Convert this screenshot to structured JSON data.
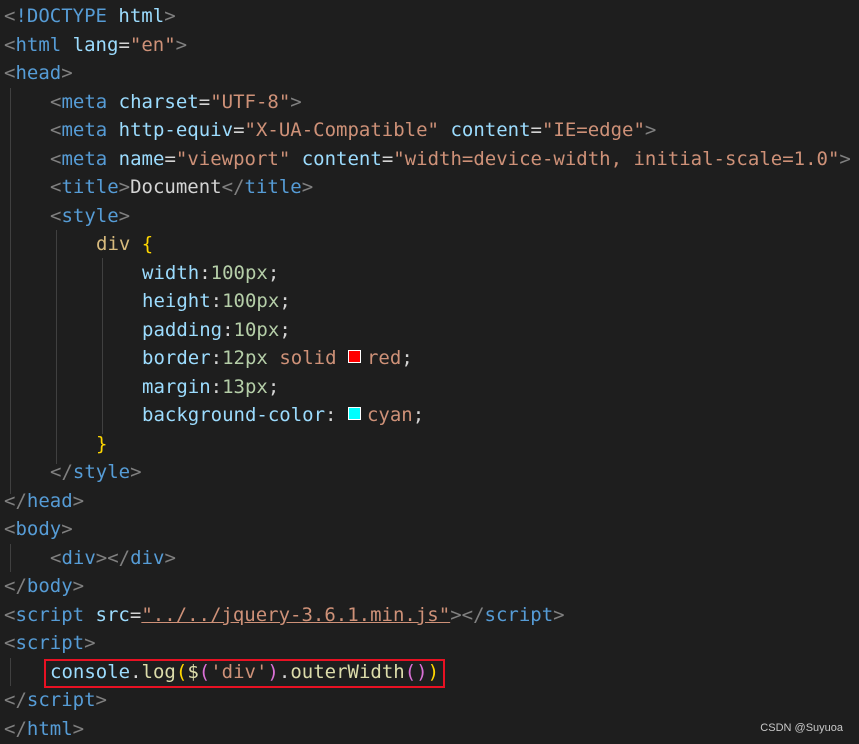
{
  "code": {
    "l1": {
      "lt": "<",
      "bang": "!DOCTYPE",
      "kw": "html",
      "gt": ">"
    },
    "l2": {
      "tag": "html",
      "attr": "lang",
      "eq": "=",
      "val": "\"en\""
    },
    "l3": {
      "tag": "head"
    },
    "l4": {
      "tag": "meta",
      "attr": "charset",
      "val": "\"UTF-8\""
    },
    "l5": {
      "tag": "meta",
      "attr1": "http-equiv",
      "val1": "\"X-UA-Compatible\"",
      "attr2": "content",
      "val2": "\"IE=edge\""
    },
    "l6": {
      "tag": "meta",
      "attr1": "name",
      "val1": "\"viewport\"",
      "attr2": "content",
      "val2": "\"width=device-width, initial-scale=1.0\""
    },
    "l7": {
      "tag": "title",
      "text": "Document"
    },
    "l8": {
      "tag": "style"
    },
    "l9": {
      "selector": "div",
      "brace": "{"
    },
    "l10": {
      "prop": "width",
      "num": "100",
      "unit": "px"
    },
    "l11": {
      "prop": "height",
      "num": "100",
      "unit": "px"
    },
    "l12": {
      "prop": "padding",
      "num": "10",
      "unit": "px"
    },
    "l13": {
      "prop": "border",
      "num": "12",
      "unit": "px",
      "style": "solid",
      "color": "red"
    },
    "l14": {
      "prop": "margin",
      "num": "13",
      "unit": "px"
    },
    "l15": {
      "prop": "background-color",
      "color": "cyan"
    },
    "l16": {
      "brace": "}"
    },
    "l17": {
      "tag": "style"
    },
    "l18": {
      "tag": "head"
    },
    "l19": {
      "tag": "body"
    },
    "l20": {
      "tag": "div"
    },
    "l21": {
      "tag": "body"
    },
    "l22": {
      "tag": "script",
      "attr": "src",
      "val": "\"../../jquery-3.6.1.min.js\""
    },
    "l23": {
      "tag": "script"
    },
    "l24": {
      "obj": "console",
      "fn": "log",
      "dollar": "$",
      "arg": "'div'",
      "method": "outerWidth"
    },
    "l25": {
      "tag": "script"
    },
    "l26": {
      "tag": "html"
    }
  },
  "swatches": {
    "red": "#ff0000",
    "cyan": "#00ffff"
  },
  "highlight_color": "#e81123",
  "watermark": "CSDN @Suyuoa"
}
